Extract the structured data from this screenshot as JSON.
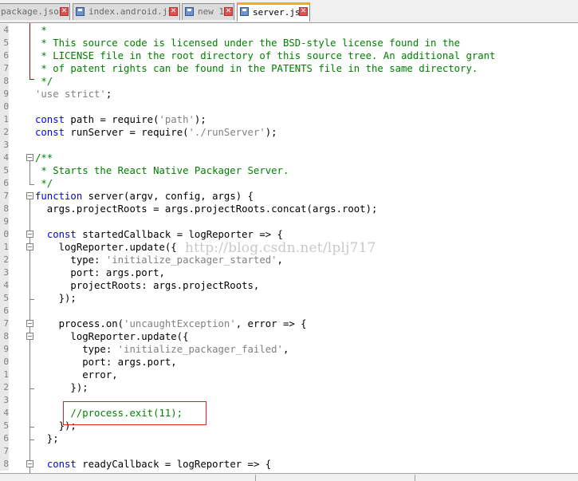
{
  "tabs": [
    {
      "label": "package.json",
      "active": false
    },
    {
      "label": "index.android.js",
      "active": false
    },
    {
      "label": "new 1",
      "active": false
    },
    {
      "label": "server.js",
      "active": true
    }
  ],
  "watermark": "http://blog.csdn.net/lplj717",
  "lines": [
    {
      "n": "4",
      "t": [
        [
          "cm",
          " *"
        ]
      ]
    },
    {
      "n": "5",
      "t": [
        [
          "cm",
          " * This source code is licensed under the BSD-style license found in the"
        ]
      ]
    },
    {
      "n": "6",
      "t": [
        [
          "cm",
          " * LICENSE file in the root directory of this source tree. An additional grant"
        ]
      ]
    },
    {
      "n": "7",
      "t": [
        [
          "cm",
          " * of patent rights can be found in the PATENTS file in the same directory."
        ]
      ]
    },
    {
      "n": "8",
      "t": [
        [
          "cm",
          " */"
        ]
      ]
    },
    {
      "n": "9",
      "t": [
        [
          "str",
          "'use strict'"
        ],
        [
          "plain",
          ";"
        ]
      ]
    },
    {
      "n": "0",
      "t": []
    },
    {
      "n": "1",
      "t": [
        [
          "kw",
          "const"
        ],
        [
          "plain",
          " path = require("
        ],
        [
          "str",
          "'path'"
        ],
        [
          "plain",
          ");"
        ]
      ]
    },
    {
      "n": "2",
      "t": [
        [
          "kw",
          "const"
        ],
        [
          "plain",
          " runServer = require("
        ],
        [
          "str",
          "'./runServer'"
        ],
        [
          "plain",
          ");"
        ]
      ]
    },
    {
      "n": "3",
      "t": []
    },
    {
      "n": "4",
      "t": [
        [
          "cm",
          "/**"
        ]
      ]
    },
    {
      "n": "5",
      "t": [
        [
          "cm",
          " * Starts the React Native Packager Server."
        ]
      ]
    },
    {
      "n": "6",
      "t": [
        [
          "cm",
          " */"
        ]
      ]
    },
    {
      "n": "7",
      "t": [
        [
          "kw",
          "function"
        ],
        [
          "plain",
          " server(argv, config, args) {"
        ]
      ]
    },
    {
      "n": "8",
      "t": [
        [
          "plain",
          "  args.projectRoots = args.projectRoots.concat(args.root);"
        ]
      ]
    },
    {
      "n": "9",
      "t": []
    },
    {
      "n": "0",
      "t": [
        [
          "plain",
          "  "
        ],
        [
          "kw",
          "const"
        ],
        [
          "plain",
          " startedCallback = logReporter => {"
        ]
      ]
    },
    {
      "n": "1",
      "t": [
        [
          "plain",
          "    logReporter.update({"
        ]
      ]
    },
    {
      "n": "2",
      "t": [
        [
          "plain",
          "      type: "
        ],
        [
          "str",
          "'initialize_packager_started'"
        ],
        [
          "plain",
          ","
        ]
      ]
    },
    {
      "n": "3",
      "t": [
        [
          "plain",
          "      port: args.port,"
        ]
      ]
    },
    {
      "n": "4",
      "t": [
        [
          "plain",
          "      projectRoots: args.projectRoots,"
        ]
      ]
    },
    {
      "n": "5",
      "t": [
        [
          "plain",
          "    });"
        ]
      ]
    },
    {
      "n": "6",
      "t": []
    },
    {
      "n": "7",
      "t": [
        [
          "plain",
          "    process.on("
        ],
        [
          "str",
          "'uncaughtException'"
        ],
        [
          "plain",
          ", error => {"
        ]
      ]
    },
    {
      "n": "8",
      "t": [
        [
          "plain",
          "      logReporter.update({"
        ]
      ]
    },
    {
      "n": "9",
      "t": [
        [
          "plain",
          "        type: "
        ],
        [
          "str",
          "'initialize_packager_failed'"
        ],
        [
          "plain",
          ","
        ]
      ]
    },
    {
      "n": "0",
      "t": [
        [
          "plain",
          "        port: args.port,"
        ]
      ]
    },
    {
      "n": "1",
      "t": [
        [
          "plain",
          "        error,"
        ]
      ]
    },
    {
      "n": "2",
      "t": [
        [
          "plain",
          "      });"
        ]
      ]
    },
    {
      "n": "3",
      "t": []
    },
    {
      "n": "4",
      "t": [
        [
          "cm",
          "      //process.exit(11);"
        ]
      ]
    },
    {
      "n": "5",
      "t": [
        [
          "plain",
          "    });"
        ]
      ]
    },
    {
      "n": "6",
      "t": [
        [
          "plain",
          "  };"
        ]
      ]
    },
    {
      "n": "7",
      "t": []
    },
    {
      "n": "8",
      "t": [
        [
          "plain",
          "  "
        ],
        [
          "kw",
          "const"
        ],
        [
          "plain",
          " readyCallback = logReporter => {"
        ]
      ]
    }
  ],
  "colors": {
    "keyword": "#0000ff",
    "string": "#808080",
    "comment": "#008000",
    "highlight_box": "#e02020",
    "active_tab_accent": "#f5a623"
  }
}
